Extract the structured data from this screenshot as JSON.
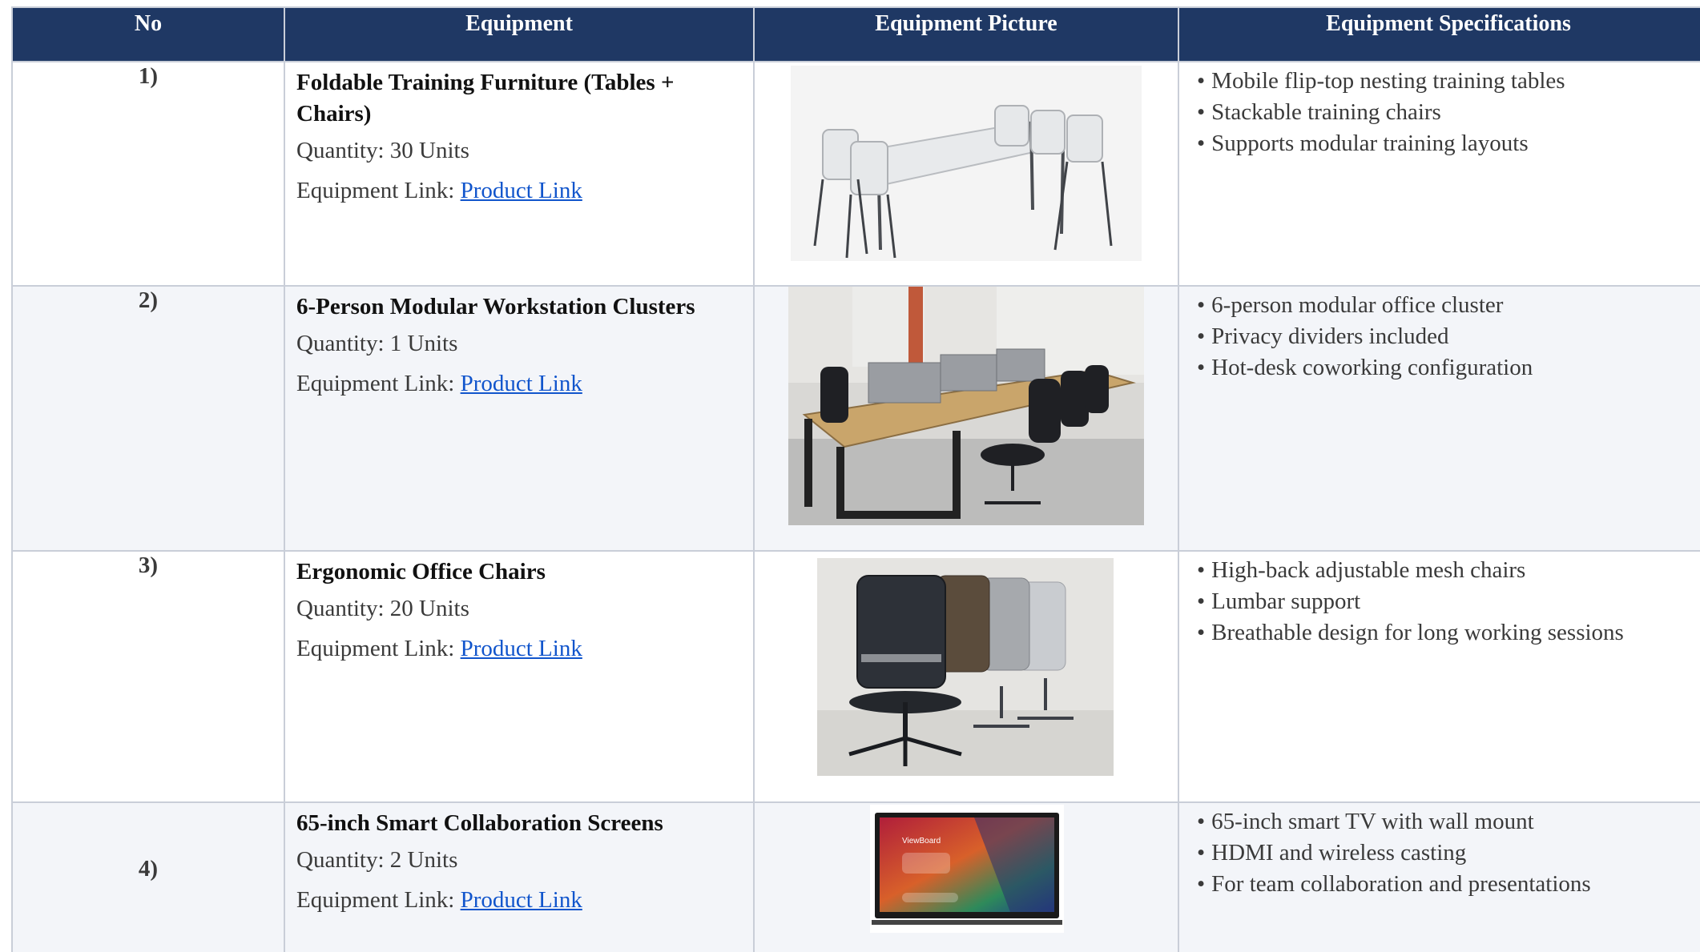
{
  "headers": {
    "no": "No",
    "equipment": "Equipment",
    "picture": "Equipment Picture",
    "specs": "Equipment Specifications"
  },
  "rows": [
    {
      "no": "1)",
      "name_line1": "Foldable Training Furniture (Tables +",
      "name_line2": "Chairs)",
      "quantity": "Quantity: 30 Units",
      "link_prefix": "Equipment Link: ",
      "link_text": "Product Link",
      "image_icon": "folding-table-chairs-photo",
      "specs": [
        "Mobile flip-top nesting training tables",
        "Stackable training chairs",
        "Supports modular training layouts"
      ]
    },
    {
      "no": "2)",
      "name_line1": "6-Person Modular Workstation Clusters",
      "name_line2": "",
      "quantity": "Quantity: 1 Units",
      "link_prefix": "Equipment Link: ",
      "link_text": "Product Link",
      "image_icon": "workstation-cluster-photo",
      "specs": [
        "6-person modular office cluster",
        "Privacy dividers included",
        "Hot-desk coworking configuration"
      ]
    },
    {
      "no": "3)",
      "name_line1": "Ergonomic Office Chairs",
      "name_line2": "",
      "quantity": "Quantity: 20 Units",
      "link_prefix": "Equipment Link: ",
      "link_text": "Product Link",
      "image_icon": "office-chairs-photo",
      "specs": [
        "High-back adjustable mesh chairs",
        "Lumbar support",
        "Breathable design for long working sessions"
      ]
    },
    {
      "no": "4)",
      "name_line1": "65-inch Smart Collaboration Screens",
      "name_line2": "",
      "quantity": "Quantity: 2 Units",
      "link_prefix": "Equipment Link: ",
      "link_text": "Product Link",
      "image_icon": "smart-screen-photo",
      "screen_brand": "ViewBoard",
      "specs": [
        "65-inch smart TV with wall mount",
        "HDMI and wireless casting",
        "For team collaboration and presentations"
      ]
    }
  ]
}
